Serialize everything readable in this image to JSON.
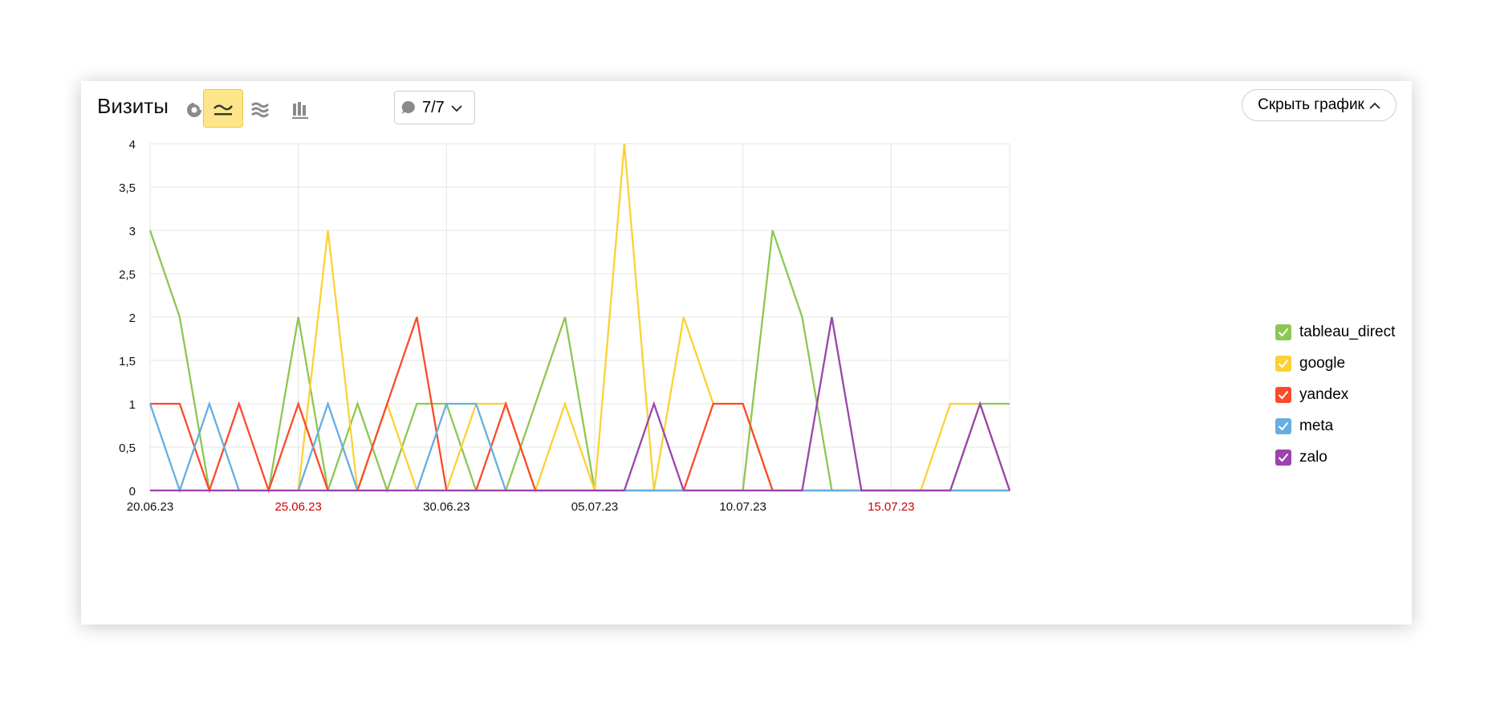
{
  "header": {
    "title": "Визиты",
    "segment_filter": "7/7",
    "hide_chart_label": "Скрыть график"
  },
  "toolbar": {
    "buttons": [
      {
        "icon": "pie-chart-icon",
        "active": false
      },
      {
        "icon": "line-chart-icon",
        "active": true
      },
      {
        "icon": "area-chart-icon",
        "active": false
      },
      {
        "icon": "bar-chart-icon",
        "active": false
      }
    ],
    "accent": "#fde58a"
  },
  "chart_data": {
    "type": "line",
    "x": [
      "20.06.23",
      "21.06.23",
      "22.06.23",
      "23.06.23",
      "24.06.23",
      "25.06.23",
      "26.06.23",
      "27.06.23",
      "28.06.23",
      "29.06.23",
      "30.06.23",
      "01.07.23",
      "02.07.23",
      "03.07.23",
      "04.07.23",
      "05.07.23",
      "06.07.23",
      "07.07.23",
      "08.07.23",
      "09.07.23",
      "10.07.23",
      "11.07.23",
      "12.07.23",
      "13.07.23",
      "14.07.23",
      "15.07.23",
      "16.07.23",
      "17.07.23",
      "18.07.23",
      "19.07.23"
    ],
    "x_ticks": [
      "20.06.23",
      "25.06.23",
      "30.06.23",
      "05.07.23",
      "10.07.23",
      "15.07.23"
    ],
    "weekend_tick_color": "#cc0000",
    "weekend_ticks": [
      "25.06.23",
      "15.07.23"
    ],
    "y_ticks": [
      "0",
      "0,5",
      "1",
      "1,5",
      "2",
      "2,5",
      "3",
      "3,5",
      "4"
    ],
    "ylim": [
      0,
      4
    ],
    "grid": true,
    "legend_position": "right",
    "series": [
      {
        "name": "tableau_direct",
        "color": "#8cc751",
        "values": [
          3,
          2,
          0,
          0,
          0,
          2,
          0,
          1,
          0,
          1,
          1,
          0,
          0,
          1,
          2,
          0,
          0,
          0,
          0,
          0,
          0,
          3,
          2,
          0,
          0,
          0,
          0,
          0,
          1,
          1
        ]
      },
      {
        "name": "google",
        "color": "#fcd135",
        "values": [
          0,
          0,
          0,
          0,
          0,
          0,
          3,
          0,
          1,
          0,
          0,
          1,
          1,
          0,
          1,
          0,
          4,
          0,
          2,
          1,
          1,
          0,
          0,
          0,
          0,
          0,
          0,
          1,
          1,
          0
        ]
      },
      {
        "name": "yandex",
        "color": "#fb4a2a",
        "values": [
          1,
          1,
          0,
          1,
          0,
          1,
          0,
          0,
          1,
          2,
          0,
          0,
          1,
          0,
          0,
          0,
          0,
          0,
          0,
          1,
          1,
          0,
          0,
          0,
          0,
          0,
          0,
          0,
          0,
          0
        ]
      },
      {
        "name": "meta",
        "color": "#65aee0",
        "values": [
          1,
          0,
          1,
          0,
          0,
          0,
          1,
          0,
          0,
          0,
          1,
          1,
          0,
          0,
          0,
          0,
          0,
          0,
          0,
          0,
          0,
          0,
          0,
          0,
          0,
          0,
          0,
          0,
          0,
          0
        ]
      },
      {
        "name": "zalo",
        "color": "#9b44ad",
        "values": [
          0,
          0,
          0,
          0,
          0,
          0,
          0,
          0,
          0,
          0,
          0,
          0,
          0,
          0,
          0,
          0,
          0,
          1,
          0,
          0,
          0,
          0,
          0,
          2,
          0,
          0,
          0,
          0,
          1,
          0
        ]
      }
    ]
  }
}
